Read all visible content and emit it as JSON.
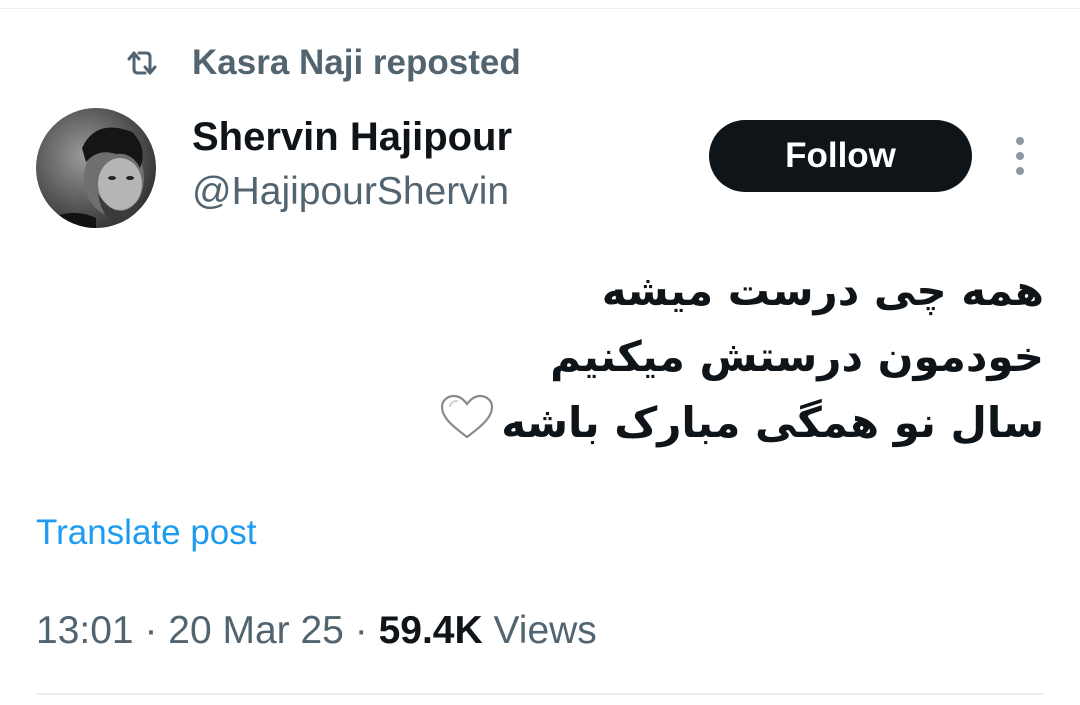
{
  "repost": {
    "icon": "repost-icon",
    "text": "Kasra Naji reposted"
  },
  "author": {
    "name": "Shervin Hajipour",
    "handle": "@HajipourShervin",
    "avatar": "avatar"
  },
  "actions": {
    "follow_label": "Follow",
    "more_icon": "more-vertical-icon"
  },
  "post": {
    "lines": [
      "همه چی درست میشه",
      "خودمون درستش میکنیم",
      "سال نو همگی مبارک باشه"
    ],
    "emoji": "white-heart-icon"
  },
  "translate_label": "Translate post",
  "meta": {
    "time": "13:01",
    "sep1": " · ",
    "date": "20 Mar 25",
    "sep2": " · ",
    "views_count": "59.4K",
    "views_label": " Views"
  },
  "colors": {
    "text_primary": "#0f1419",
    "text_secondary": "#536471",
    "link": "#1d9bf0",
    "button_bg": "#0f1419",
    "button_text": "#ffffff"
  }
}
